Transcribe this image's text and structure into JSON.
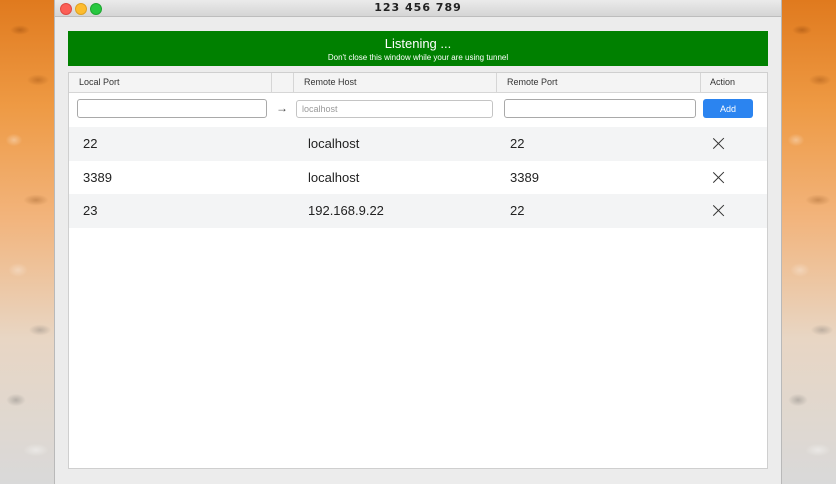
{
  "window": {
    "title": "123 456 789"
  },
  "banner": {
    "title": "Listening ...",
    "subtitle": "Don't close this window while your are using tunnel",
    "color": "#008000"
  },
  "table": {
    "headers": {
      "local_port": "Local Port",
      "remote_host": "Remote Host",
      "remote_port": "Remote Port",
      "action": "Action"
    },
    "new_entry": {
      "local_port_value": "",
      "remote_host_value": "",
      "remote_host_placeholder": "localhost",
      "remote_port_value": "",
      "arrow_icon": "arrow-right-icon",
      "add_label": "Add",
      "add_color": "#2b84f0"
    },
    "rows": [
      {
        "local_port": "22",
        "remote_host": "localhost",
        "remote_port": "22",
        "delete_icon": "close-icon"
      },
      {
        "local_port": "3389",
        "remote_host": "localhost",
        "remote_port": "3389",
        "delete_icon": "close-icon"
      },
      {
        "local_port": "23",
        "remote_host": "192.168.9.22",
        "remote_port": "22",
        "delete_icon": "close-icon"
      }
    ]
  }
}
